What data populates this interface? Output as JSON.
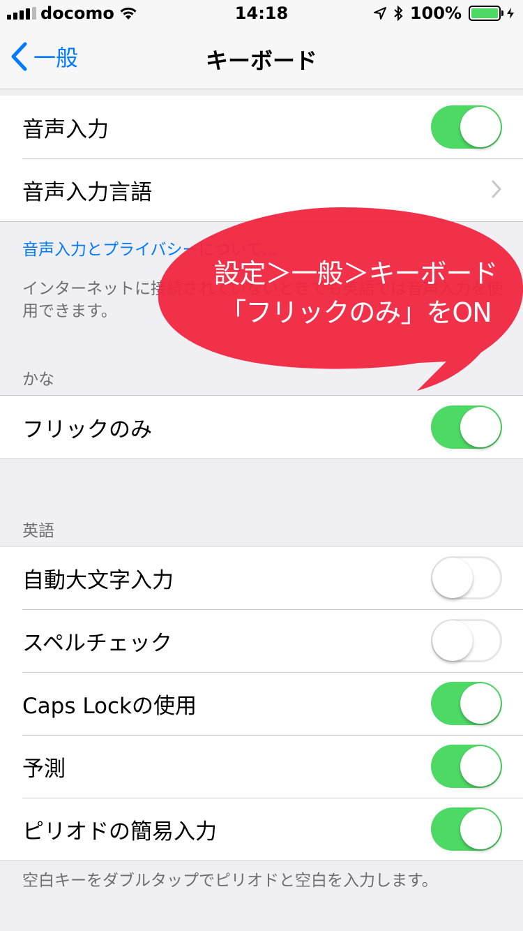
{
  "status": {
    "carrier": "docomo",
    "time": "14:18",
    "battery": "100%"
  },
  "nav": {
    "back_label": "一般",
    "title": "キーボード"
  },
  "dictation": {
    "items": [
      {
        "label": "音声入力",
        "toggle": "on"
      },
      {
        "label": "音声入力言語",
        "toggle": "none"
      }
    ],
    "privacy_link": "音声入力とプライバシーについて...",
    "footer": "インターネットに接続されていないときでも英語では音声入力を使用できます。"
  },
  "kana": {
    "header": "かな",
    "items": [
      {
        "label": "フリックのみ",
        "toggle": "on"
      }
    ]
  },
  "english": {
    "header": "英語",
    "items": [
      {
        "label": "自動大文字入力",
        "toggle": "off"
      },
      {
        "label": "スペルチェック",
        "toggle": "off"
      },
      {
        "label": "Caps Lockの使用",
        "toggle": "on"
      },
      {
        "label": "予測",
        "toggle": "on"
      },
      {
        "label": "ピリオドの簡易入力",
        "toggle": "on"
      }
    ],
    "footer": "空白キーをダブルタップでピリオドと空白を入力します。"
  },
  "annotation": {
    "line1": "設定＞一般＞キーボード",
    "line2": "「フリックのみ」をON"
  },
  "colors": {
    "accent": "#007aff",
    "toggle_on": "#4cd964",
    "bubble": "#f0263f"
  }
}
